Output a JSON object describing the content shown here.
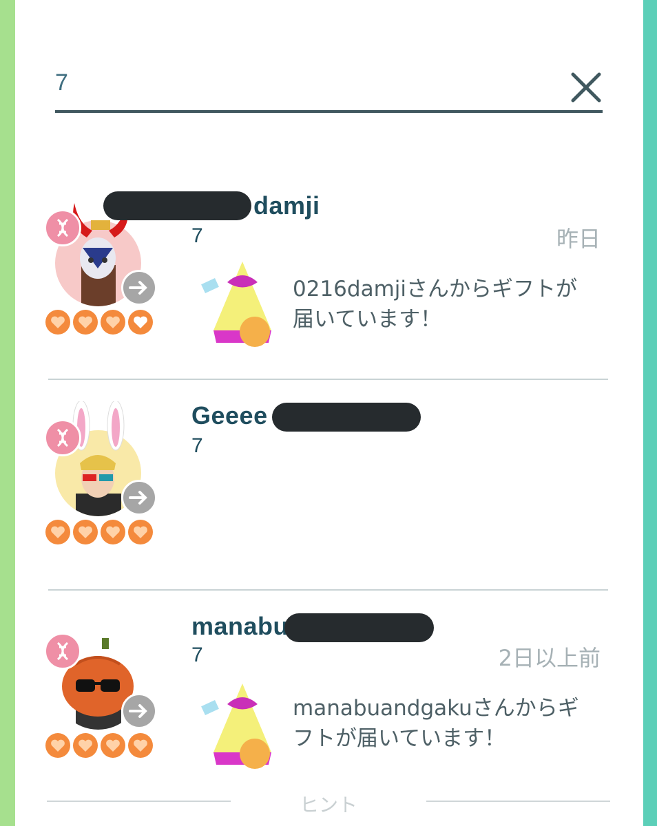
{
  "search": {
    "value": "7"
  },
  "friends": [
    {
      "name_visible": "damji",
      "level": "7",
      "time": "昨日",
      "gift_message": "0216damjiさんからギフトが届いています！",
      "hearts": 4,
      "avatar_bg": "#f7c9c8"
    },
    {
      "name_visible": "Geeee",
      "level": "7",
      "time": "",
      "gift_message": "",
      "hearts": 4,
      "avatar_bg": "#f9e9a8"
    },
    {
      "name_visible": "manabu",
      "level": "7",
      "time": "2日以上前",
      "gift_message": "manabuandgakuさんからギフトが届いています！",
      "hearts": 4,
      "avatar_bg": "#ffffff"
    }
  ],
  "hint": {
    "label": "ヒント"
  },
  "colors": {
    "accent": "#1f4d5e",
    "heart": "#f48a3c",
    "badge": "#ef8fa6",
    "left_edge": "#a6e08e",
    "right_edge": "#5ccfb8"
  }
}
